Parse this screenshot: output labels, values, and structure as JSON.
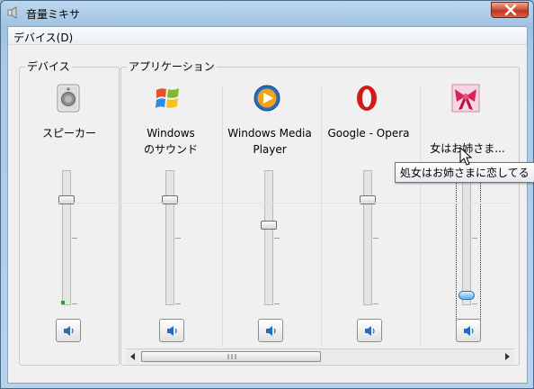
{
  "window": {
    "title": "音量ミキサ",
    "icon": "speaker-icon",
    "close_icon": "close-icon"
  },
  "menu": {
    "device": "デバイス(D)"
  },
  "groups": {
    "device_label": "デバイス",
    "apps_label": "アプリケーション"
  },
  "device": {
    "name": "スピーカー",
    "icon": "speaker-device-icon",
    "volume_percent": 80,
    "peak_percent": 1
  },
  "apps": [
    {
      "name_lines": [
        "Windows",
        "のサウンド"
      ],
      "icon": "windows-flag-icon",
      "volume_percent": 80
    },
    {
      "name_lines": [
        "Windows Media",
        "Player"
      ],
      "icon": "media-player-icon",
      "volume_percent": 60
    },
    {
      "name_lines": [
        "Google - Opera"
      ],
      "icon": "opera-icon",
      "volume_percent": 80
    },
    {
      "name_lines": [
        "女はお姉さま..."
      ],
      "icon": "ribbon-app-icon",
      "volume_percent": 4
    }
  ],
  "tooltip": "処女はお姉さまに恋してる",
  "colors": {
    "accent": "#2f6fa3",
    "close": "#c2321b",
    "peak": "#27a52b"
  }
}
